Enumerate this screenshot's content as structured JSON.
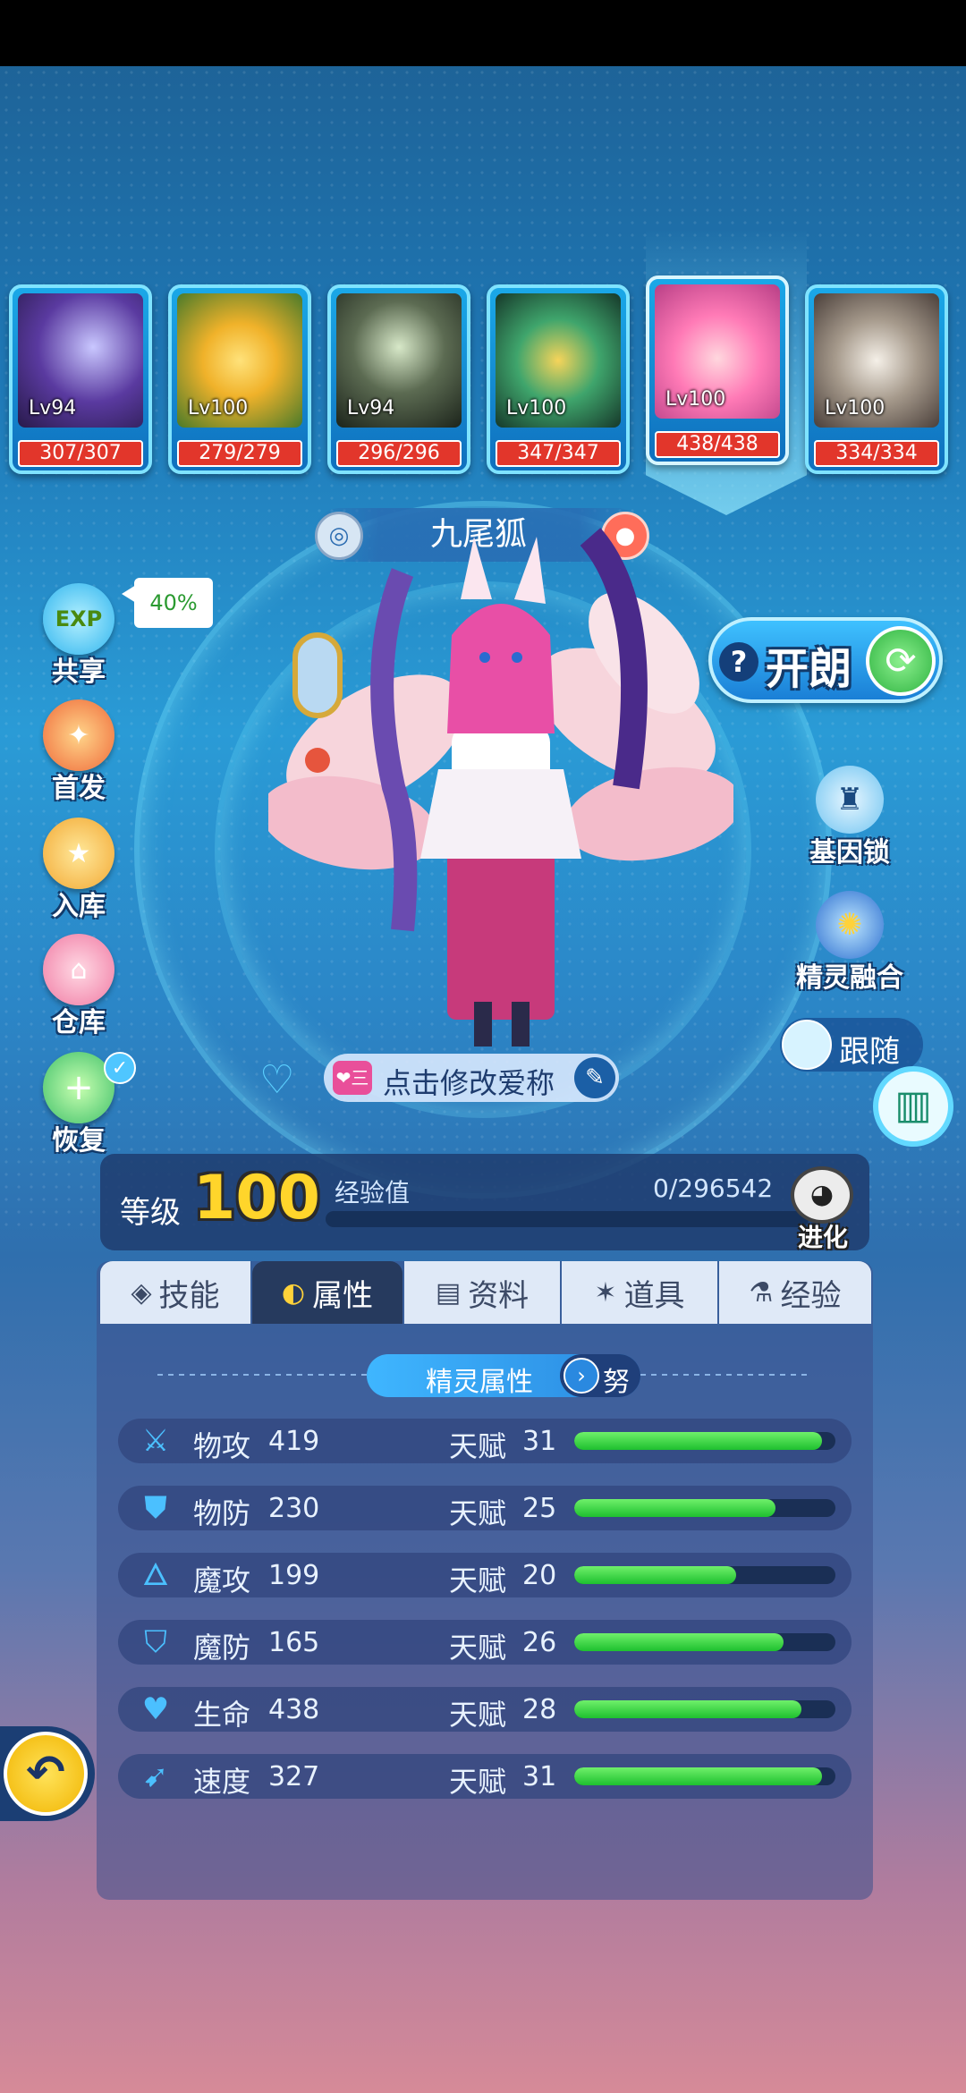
{
  "roster": [
    {
      "level": "Lv94",
      "hp": "307/307",
      "art": "dark-dragon-icon",
      "color": "#3a2a6e"
    },
    {
      "level": "Lv100",
      "hp": "279/279",
      "art": "green-beast-icon",
      "color": "#d9a423"
    },
    {
      "level": "Lv94",
      "hp": "296/296",
      "art": "armored-mech-icon",
      "color": "#3b4a3a"
    },
    {
      "level": "Lv100",
      "hp": "347/347",
      "art": "green-knight-icon",
      "color": "#2f8a5a"
    },
    {
      "level": "Lv100",
      "hp": "438/438",
      "art": "pink-fox-girl-icon",
      "color": "#e86bb0",
      "selected": true
    },
    {
      "level": "Lv100",
      "hp": "334/334",
      "art": "white-wolf-icon",
      "color": "#9a8a7e"
    }
  ],
  "pet": {
    "name": "九尾狐"
  },
  "side_buttons": [
    {
      "label": "共享",
      "icon": "exp-share-icon",
      "badge": "EXP"
    },
    {
      "label": "首发",
      "icon": "first-launch-icon"
    },
    {
      "label": "入库",
      "icon": "store-icon"
    },
    {
      "label": "仓库",
      "icon": "warehouse-icon"
    },
    {
      "label": "恢复",
      "icon": "recover-icon"
    }
  ],
  "share_bubble": "40%",
  "kailang": {
    "label": "开朗",
    "help": "?"
  },
  "right_buttons": [
    {
      "label": "基因锁",
      "icon": "gene-lock-icon"
    },
    {
      "label": "精灵融合",
      "icon": "fusion-icon"
    }
  ],
  "follow": {
    "label": "跟随"
  },
  "nickname": {
    "tag": "❤三",
    "label": "点击修改爱称"
  },
  "level": {
    "label": "等级",
    "value": "100",
    "exp_label": "经验值",
    "exp": "0/296542",
    "progress": 0
  },
  "evolve": {
    "label": "进化"
  },
  "tabs": [
    {
      "label": "技能",
      "icon": "skill-icon",
      "active": false
    },
    {
      "label": "属性",
      "icon": "attribute-icon",
      "active": true
    },
    {
      "label": "资料",
      "icon": "profile-icon",
      "active": false
    },
    {
      "label": "道具",
      "icon": "item-icon",
      "active": false
    },
    {
      "label": "经验",
      "icon": "exp-flask-icon",
      "active": false
    }
  ],
  "attr_header": {
    "title": "精灵属性",
    "nature": "努"
  },
  "talent_label": "天赋",
  "stats": [
    {
      "name": "物攻",
      "value": "419",
      "talent": "31",
      "icon": "sword-icon",
      "fill": 0.95
    },
    {
      "name": "物防",
      "value": "230",
      "talent": "25",
      "icon": "shield-icon",
      "fill": 0.77
    },
    {
      "name": "魔攻",
      "value": "199",
      "talent": "20",
      "icon": "flame-icon",
      "fill": 0.62
    },
    {
      "name": "魔防",
      "value": "165",
      "talent": "26",
      "icon": "magic-shield-icon",
      "fill": 0.8
    },
    {
      "name": "生命",
      "value": "438",
      "talent": "28",
      "icon": "heart-plus-icon",
      "fill": 0.87
    },
    {
      "name": "速度",
      "value": "327",
      "talent": "31",
      "icon": "boot-icon",
      "fill": 0.95
    }
  ]
}
